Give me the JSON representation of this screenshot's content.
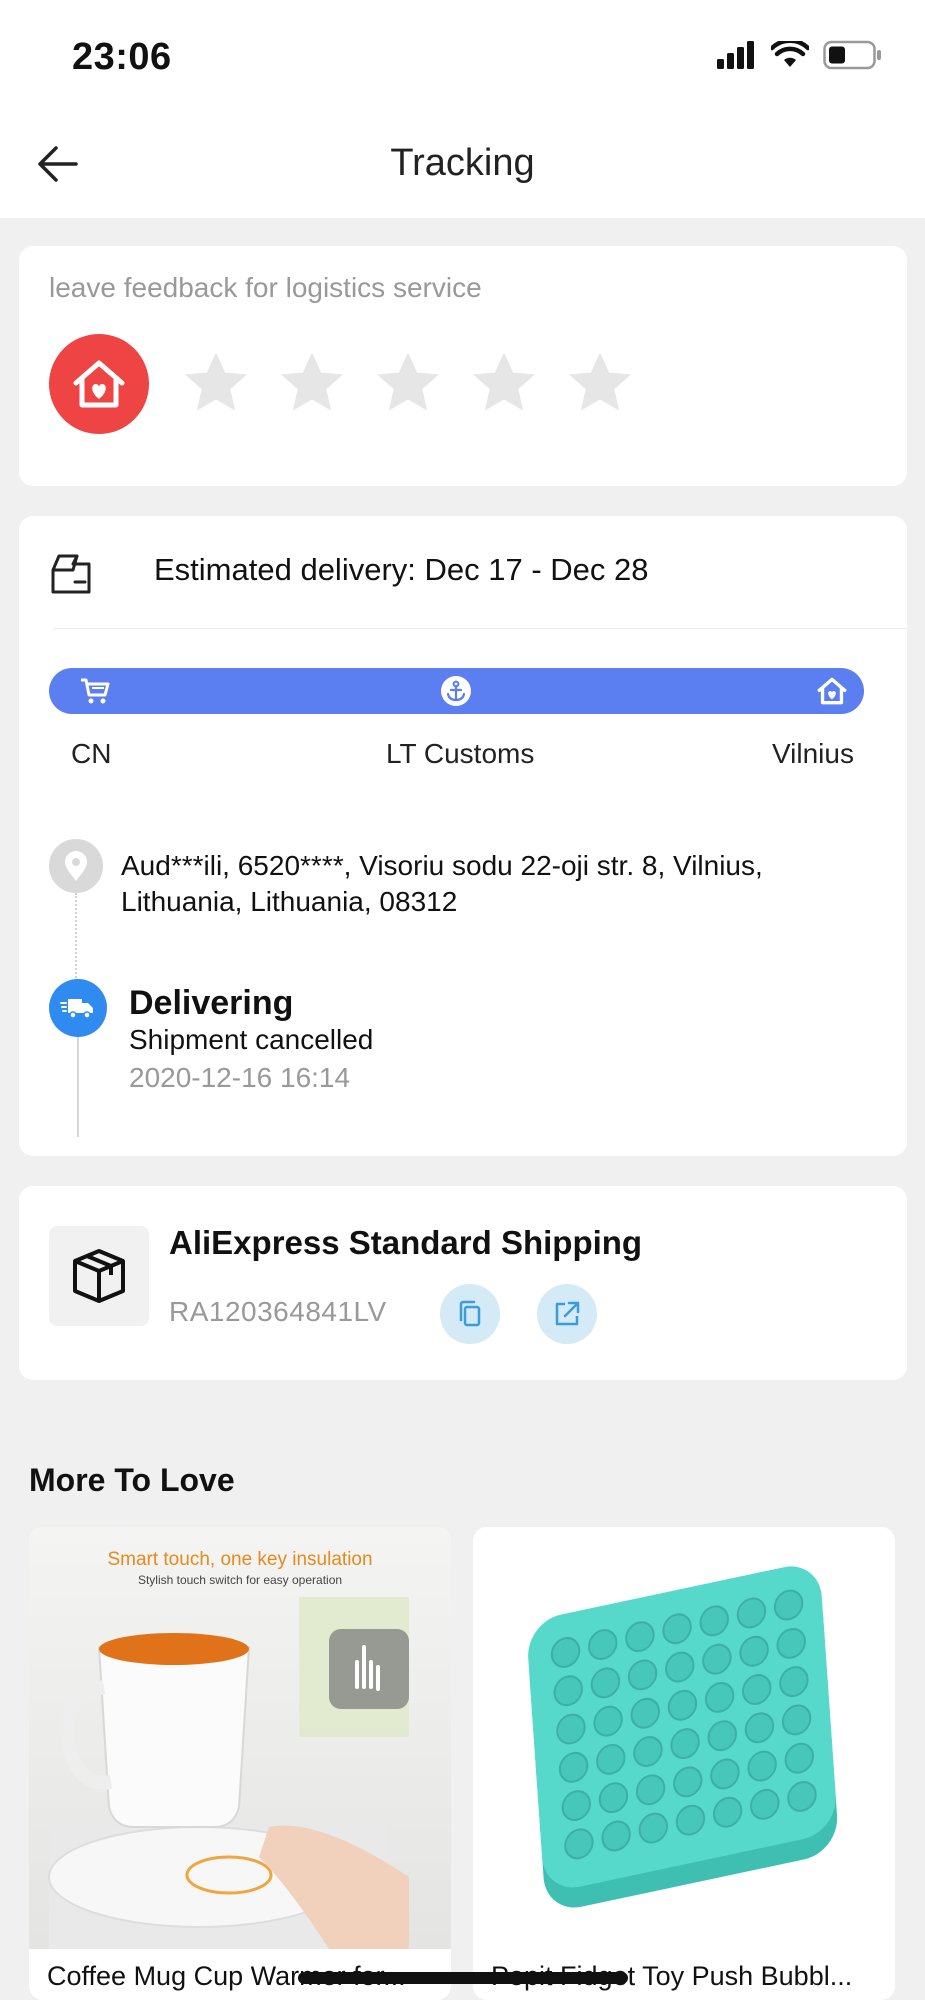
{
  "status_bar": {
    "time": "23:06",
    "icons": [
      "signal-icon",
      "wifi-icon",
      "battery-icon"
    ]
  },
  "header": {
    "title": "Tracking",
    "back_icon": "arrow-left-icon"
  },
  "feedback": {
    "label": "leave feedback for logistics service",
    "avatar_icon": "house-heart-icon",
    "rating": 0,
    "max_rating": 5
  },
  "delivery": {
    "estimated": "Estimated delivery: Dec 17 - Dec 28",
    "progress": {
      "stages": [
        {
          "label": "CN",
          "icon": "cart-icon"
        },
        {
          "label": "LT Customs",
          "icon": "anchor-icon"
        },
        {
          "label": "Vilnius",
          "icon": "house-heart-icon"
        }
      ]
    },
    "address": "Aud***ili,  6520****,  Visoriu sodu 22-oji str. 8,  Vilnius,  Lithuania,  Lithuania,  08312",
    "event": {
      "status": "Delivering",
      "detail": "Shipment cancelled",
      "time": "2020-12-16 16:14"
    }
  },
  "shipping": {
    "carrier": "AliExpress Standard Shipping",
    "tracking_number": "RA120364841LV",
    "copy_icon": "copy-icon",
    "open_icon": "external-link-icon"
  },
  "recommendations": {
    "title": "More To Love",
    "items": [
      {
        "name": "Coffee Mug Cup Warmer for...",
        "banner": "Smart touch, one key insulation",
        "banner_sub": "Stylish touch switch for easy operation"
      },
      {
        "name": "Popit Fidget Toy Push Bubbl..."
      }
    ]
  },
  "colors": {
    "accent": "#5b7ff0",
    "status_blue": "#2f8bef",
    "feedback_red": "#ef4444",
    "fidget_teal": "#4fd6c8"
  }
}
